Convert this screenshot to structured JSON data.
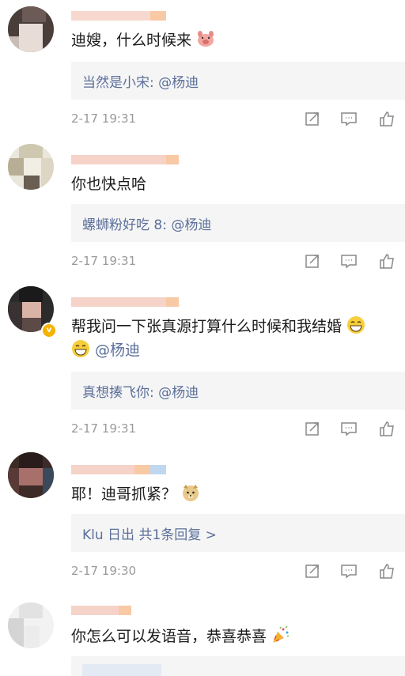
{
  "comments": [
    {
      "text_parts": [
        "迪嫂，什么时候来"
      ],
      "emoji": "pig-face-emoji",
      "reply": "当然是小宋: @杨迪",
      "time": "2-17 19:31"
    },
    {
      "text": "你也快点哈",
      "reply": "螺蛳粉好吃 8: @杨迪",
      "time": "2-17 19:31"
    },
    {
      "text_line1": "帮我问一下张真源打算什么时候和我结婚",
      "text_line2_mention": "@杨迪",
      "emoji": "grinning-face-emoji",
      "reply": "真想揍飞你: @杨迪",
      "time": "2-17 19:31",
      "verified_badge": "v"
    },
    {
      "text": "耶！迪哥抓紧？",
      "emoji": "doge-emoji",
      "reply": "Klu 日出  共1条回复 >",
      "time": "2-17 19:30"
    },
    {
      "text": "你怎么可以发语音，恭喜恭喜",
      "emoji": "party-popper-emoji"
    }
  ],
  "colors": {
    "link": "#5b6f9a",
    "meta": "#9a9a9a",
    "reply_bg": "#f5f5f5",
    "text": "#1a1a1a"
  }
}
